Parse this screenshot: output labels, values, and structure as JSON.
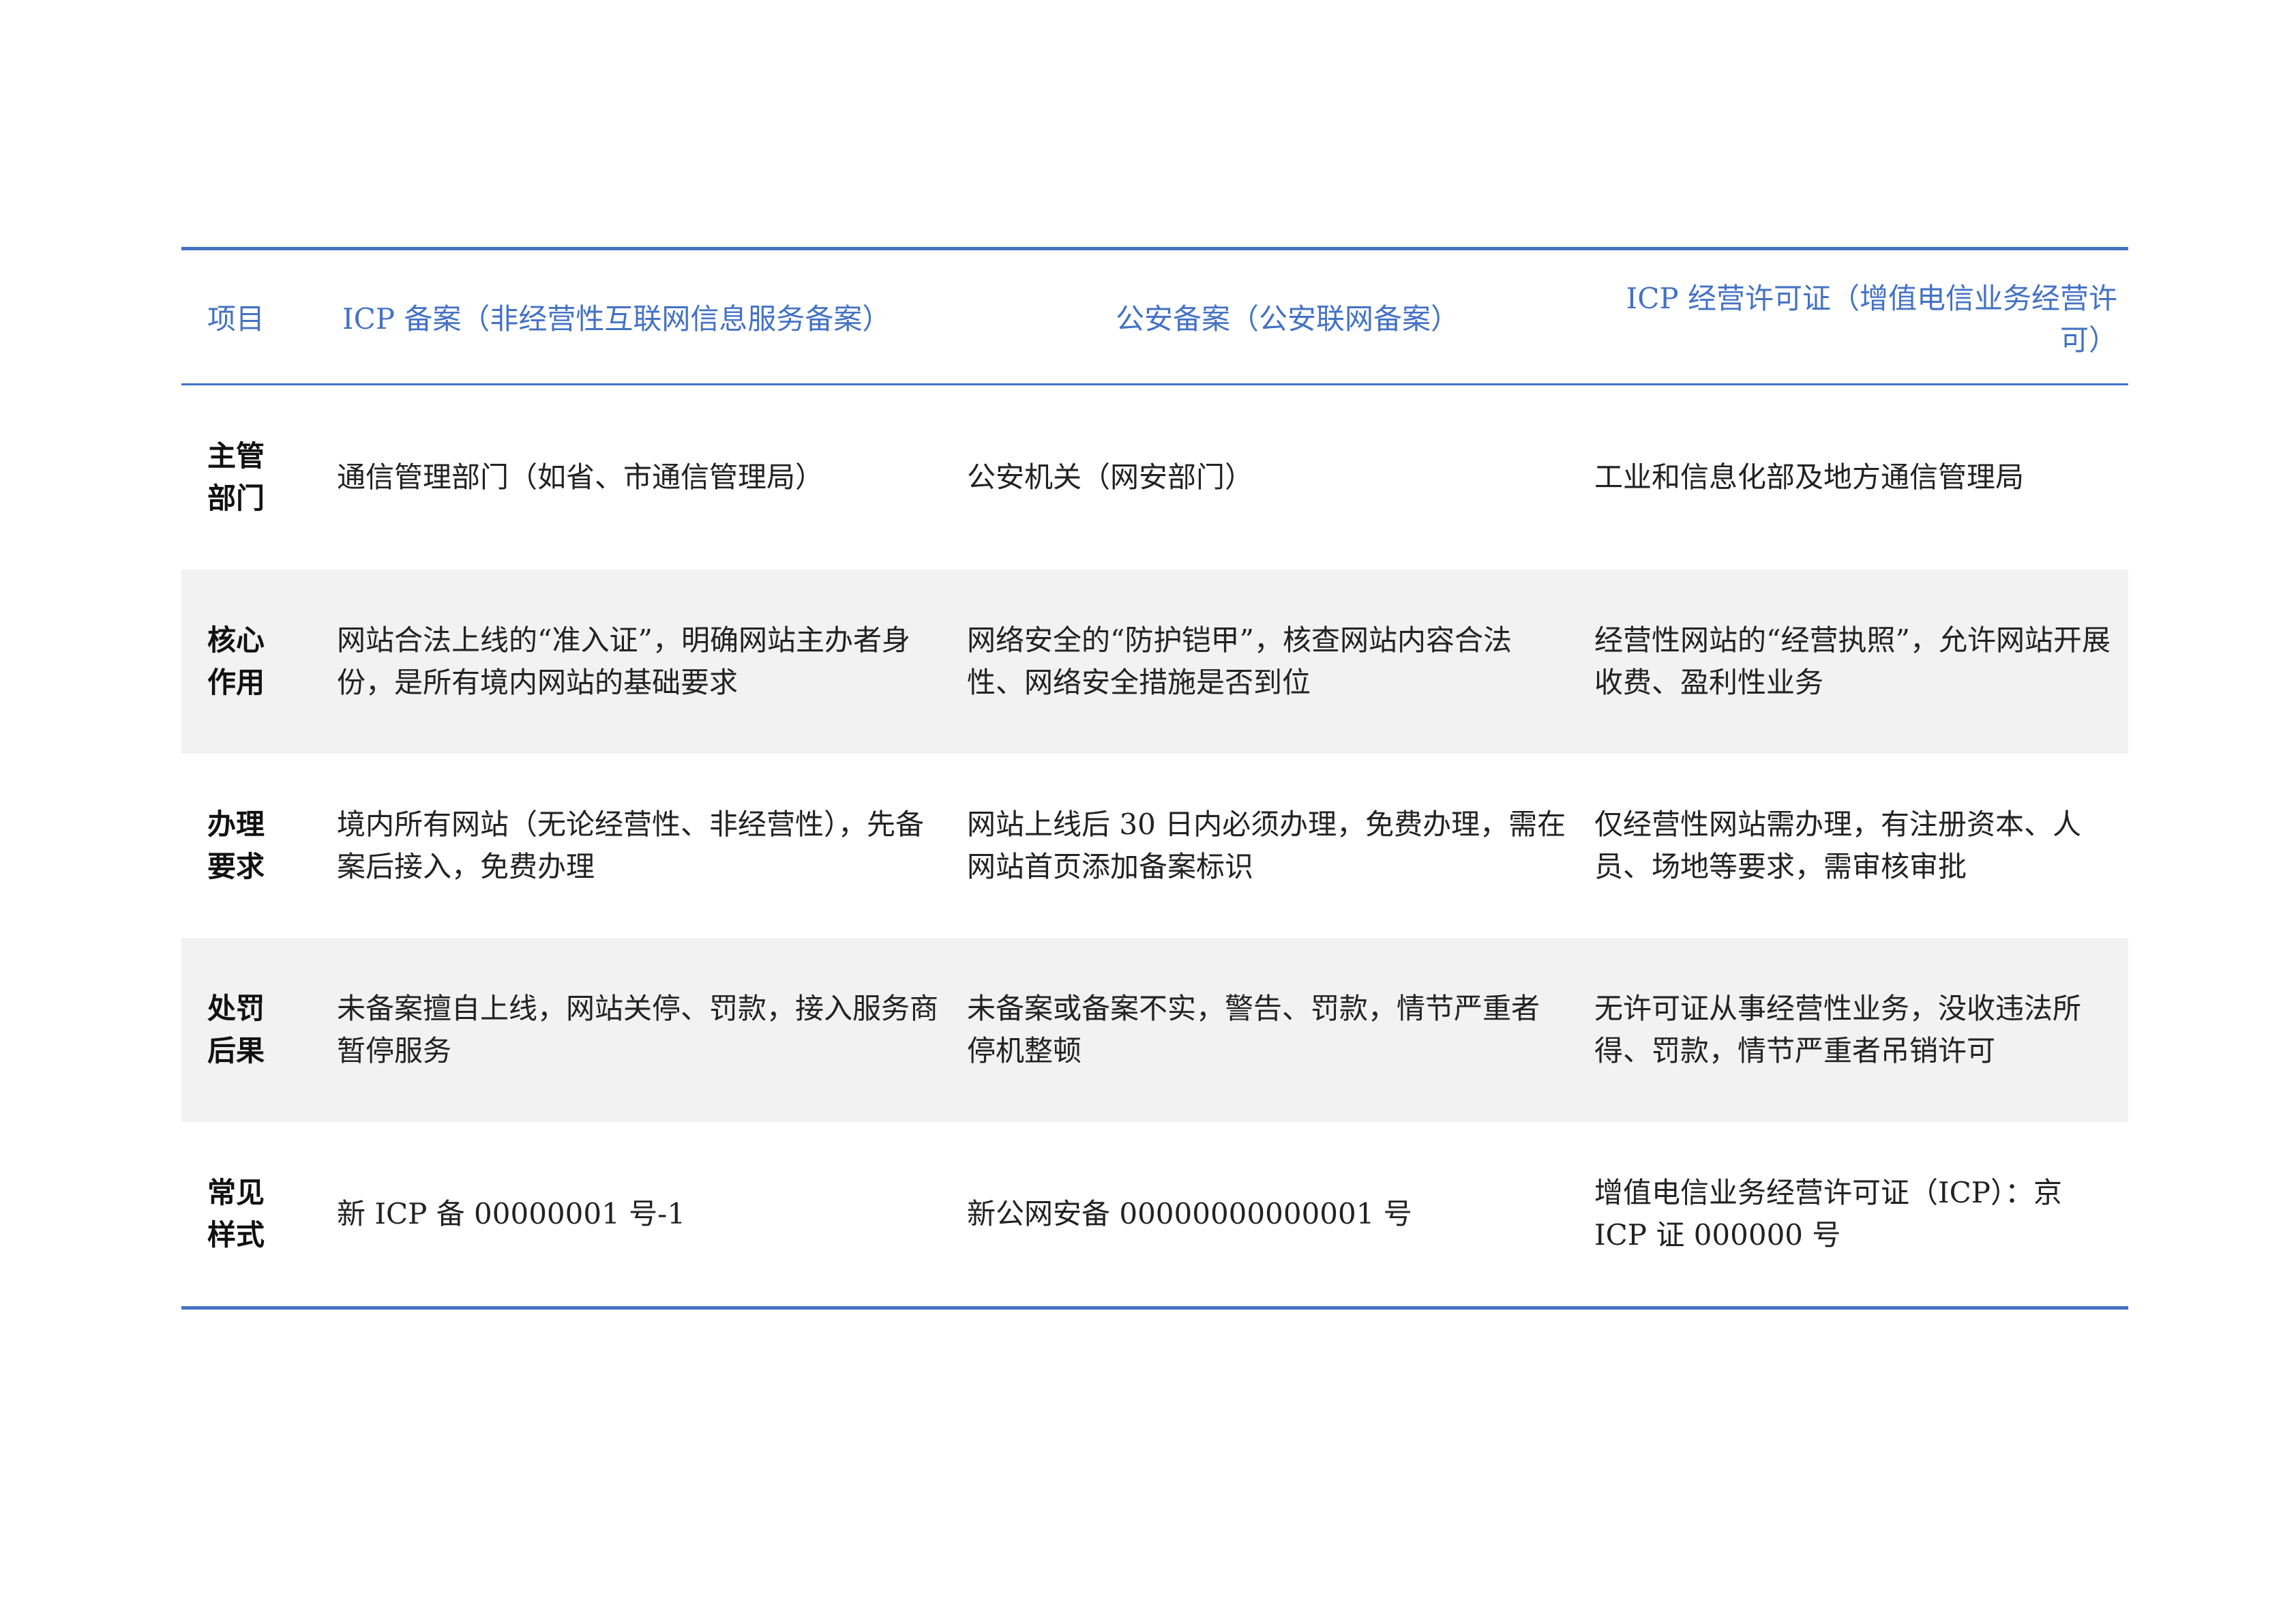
{
  "table": {
    "headers": [
      "项目",
      "ICP 备案（非经营性互联网信息服务备案）",
      "公安备案（公安联网备案）",
      "ICP 经营许可证（增值电信业务经营许可）"
    ],
    "rows": [
      {
        "label_line1": "主管",
        "label_line2": "部门",
        "icp": "通信管理部门（如省、市通信管理局）",
        "police": "公安机关（网安部门）",
        "license": "工业和信息化部及地方通信管理局"
      },
      {
        "label_line1": "核心",
        "label_line2": "作用",
        "icp": "网站合法上线的“准入证”，明确网站主办者身份，是所有境内网站的基础要求",
        "police": "网络安全的“防护铠甲”，核查网站内容合法性、网络安全措施是否到位",
        "license": "经营性网站的“经营执照”，允许网站开展收费、盈利性业务"
      },
      {
        "label_line1": "办理",
        "label_line2": "要求",
        "icp": "境内所有网站（无论经营性、非经营性），先备案后接入，免费办理",
        "police": "网站上线后 30 日内必须办理，免费办理，需在网站首页添加备案标识",
        "license": "仅经营性网站需办理，有注册资本、人员、场地等要求，需审核审批"
      },
      {
        "label_line1": "处罚",
        "label_line2": "后果",
        "icp": "未备案擅自上线，网站关停、罚款，接入服务商暂停服务",
        "police": "未备案或备案不实，警告、罚款，情节严重者停机整顿",
        "license": "无许可证从事经营性业务，没收违法所得、罚款，情节严重者吊销许可"
      },
      {
        "label_line1": "常见",
        "label_line2": "样式",
        "icp": "新 ICP 备 00000001 号-1",
        "police": "新公网安备 00000000000001 号",
        "license": "增值电信业务经营许可证（ICP）：京 ICP 证 000000 号"
      }
    ]
  },
  "colors": {
    "accent": "#4472c4",
    "shade": "#f2f2f2"
  }
}
